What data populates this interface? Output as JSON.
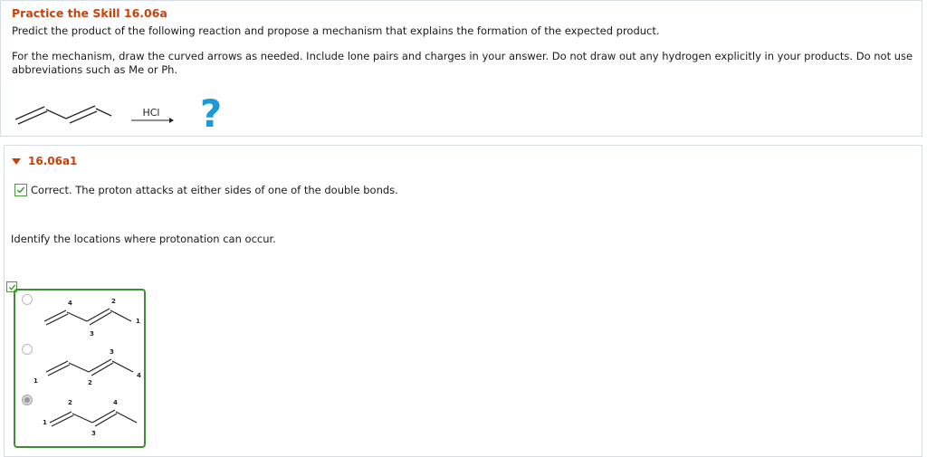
{
  "header": {
    "title": "Practice the Skill 16.06a",
    "line1": "Predict the product of the following reaction and propose a mechanism that explains the formation of the expected product.",
    "para2": "For the mechanism, draw the curved arrows as needed. Include lone pairs and charges in your answer. Do not draw out any hydrogen explicitly in your products. Do not use abbreviations such as Me or Ph."
  },
  "reaction": {
    "reagent": "HCl",
    "product_placeholder": "?",
    "question_color": "#1a9bd7"
  },
  "part": {
    "title": "16.06a1",
    "feedback": "Correct. The proton attacks at either sides of one of the double bonds.",
    "prompt": "Identify the locations where protonation can occur."
  },
  "options": [
    {
      "selected": false,
      "labels": [
        "4",
        "2",
        "3",
        "1"
      ]
    },
    {
      "selected": false,
      "labels": [
        "1",
        "2",
        "3",
        "4"
      ]
    },
    {
      "selected": true,
      "labels": [
        "2",
        "4",
        "1",
        "3"
      ]
    }
  ],
  "colors": {
    "accent": "#c8410a",
    "correct_green": "#3e8e35",
    "border": "#d6dde3"
  }
}
